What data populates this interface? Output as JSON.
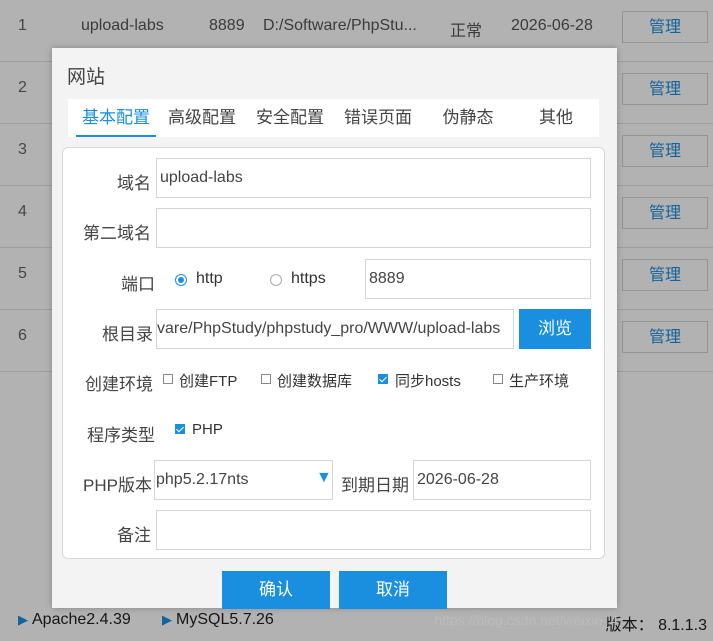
{
  "table": {
    "rows": [
      {
        "num": "1",
        "name": "upload-labs",
        "port": "8889",
        "path": "D:/Software/PhpStu...",
        "status": "正常",
        "date": "2026-06-28",
        "action": "管理"
      },
      {
        "num": "2",
        "action": "管理"
      },
      {
        "num": "3",
        "action": "管理"
      },
      {
        "num": "4",
        "action": "管理"
      },
      {
        "num": "5",
        "action": "管理"
      },
      {
        "num": "6",
        "action": "管理"
      }
    ]
  },
  "bottom_bar": {
    "apache": "Apache2.4.39",
    "mysql": "MySQL5.7.26",
    "version_label": "版本：",
    "version_value": "8.1.1.3",
    "watermark": "https://blog.csdn.net/weixin_4"
  },
  "dialog": {
    "title": "网站",
    "tabs": [
      {
        "label": "基本配置",
        "active": true
      },
      {
        "label": "高级配置"
      },
      {
        "label": "安全配置"
      },
      {
        "label": "错误页面"
      },
      {
        "label": "伪静态"
      },
      {
        "label": "其他"
      }
    ],
    "form": {
      "domain_label": "域名",
      "domain_value": "upload-labs",
      "second_domain_label": "第二域名",
      "second_domain_value": "",
      "port_label": "端口",
      "port_http": "http",
      "port_https": "https",
      "port_value": "8889",
      "root_label": "根目录",
      "root_value": "vare/PhpStudy/phpstudy_pro/WWW/upload-labs",
      "browse_label": "浏览",
      "env_label": "创建环境",
      "env_options": [
        {
          "label": "创建FTP",
          "checked": false
        },
        {
          "label": "创建数据库",
          "checked": false
        },
        {
          "label": "同步hosts",
          "checked": true
        },
        {
          "label": "生产环境",
          "checked": false
        }
      ],
      "program_type_label": "程序类型",
      "program_type_option": "PHP",
      "php_version_label": "PHP版本",
      "php_version_value": "php5.2.17nts",
      "expire_label": "到期日期",
      "expire_value": "2026-06-28",
      "note_label": "备注",
      "note_value": ""
    },
    "confirm_label": "确认",
    "cancel_label": "取消"
  },
  "colors": {
    "accent": "#1a8fe0",
    "overlay": "rgba(0,0,0,0.30)"
  }
}
